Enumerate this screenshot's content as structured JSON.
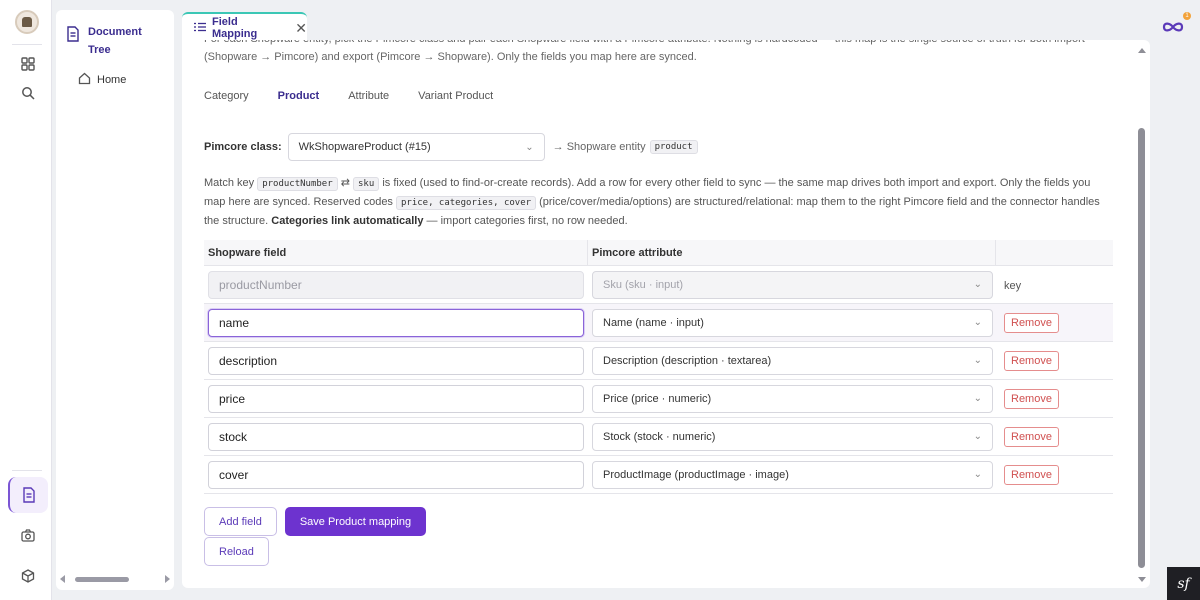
{
  "sidebar": {
    "tree_title": "Document Tree",
    "home_label": "Home"
  },
  "tab": {
    "label": "Field Mapping"
  },
  "notification_count": "1",
  "intro": {
    "line1": "For each Shopware entity, pick the Pimcore class and pair each Shopware field with a Pimcore attribute. Nothing is hardcoded — this map is the single source of truth for both import",
    "line2": "(Shopware → Pimcore) and export (Pimcore → Shopware). Only the fields you map here are synced."
  },
  "sub_tabs": [
    "Category",
    "Product",
    "Attribute",
    "Variant Product"
  ],
  "class_row": {
    "label": "Pimcore class:",
    "selected": "WkShopwareProduct (#15)",
    "entity_prefix": "→ Shopware entity",
    "entity_code": "product"
  },
  "help": {
    "t1": "Match key",
    "code1": "productNumber",
    "swap": "⇄",
    "code2": "sku",
    "t2": "is fixed (used to find-or-create records). Add a row for every other field to sync — the same map drives both import and export. Only the fields you map here are synced. Reserved codes",
    "code3": "price, categories, cover",
    "t3": "(price/cover/media/options) are structured/relational: map them to the right Pimcore field and the connector handles the structure.",
    "bold": "Categories link automatically",
    "t4": "— import categories first, no row needed."
  },
  "table": {
    "col1": "Shopware field",
    "col2": "Pimcore attribute",
    "key_label": "key",
    "remove_label": "Remove",
    "rows": [
      {
        "field": "productNumber",
        "attribute": "Sku (sku · input)"
      },
      {
        "field": "name",
        "attribute": "Name (name · input)"
      },
      {
        "field": "description",
        "attribute": "Description (description · textarea)"
      },
      {
        "field": "price",
        "attribute": "Price (price · numeric)"
      },
      {
        "field": "stock",
        "attribute": "Stock (stock · numeric)"
      },
      {
        "field": "cover",
        "attribute": "ProductImage (productImage · image)"
      }
    ]
  },
  "buttons": {
    "add_field": "Add field",
    "save": "Save Product mapping",
    "reload": "Reload"
  },
  "colors": {
    "accent": "#6d33cf",
    "tab_border": "#3bc7b5",
    "remove": "#d05050"
  }
}
